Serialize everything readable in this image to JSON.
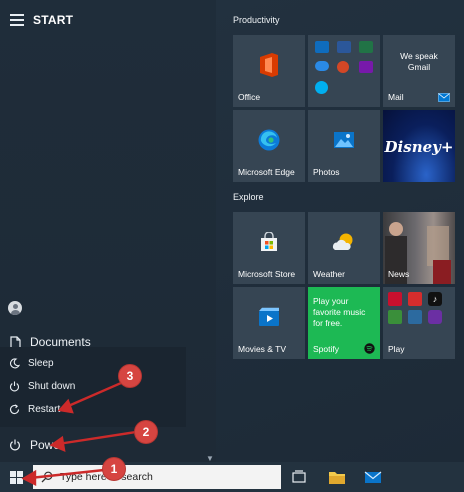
{
  "header": {
    "title": "START"
  },
  "left_rail": {
    "documents_label": "Documents",
    "power_label": "Power",
    "power_menu": [
      {
        "label": "Sleep",
        "icon": "moon-icon"
      },
      {
        "label": "Shut down",
        "icon": "power-icon"
      },
      {
        "label": "Restart",
        "icon": "restart-icon"
      }
    ]
  },
  "groups": [
    {
      "title": "Productivity"
    },
    {
      "title": "Explore"
    }
  ],
  "tiles": {
    "office": "Office",
    "mail": "Mail",
    "mail_promo": "We speak Gmail",
    "edge": "Microsoft Edge",
    "photos": "Photos",
    "disney": "Disney+",
    "store": "Microsoft Store",
    "weather": "Weather",
    "news": "News",
    "movies": "Movies & TV",
    "spotify_promo": "Play your favorite music for free.",
    "spotify": "Spotify",
    "play": "Play"
  },
  "taskbar": {
    "search_placeholder": "Type here to search"
  },
  "callouts": [
    "1",
    "2",
    "3"
  ],
  "colors": {
    "spotify_tile": "#1db954",
    "disney_tile": "#0a1f5c",
    "office_accent": "#d83b01",
    "callout_red": "#d64541",
    "arrow_red": "#cc2a2a"
  }
}
